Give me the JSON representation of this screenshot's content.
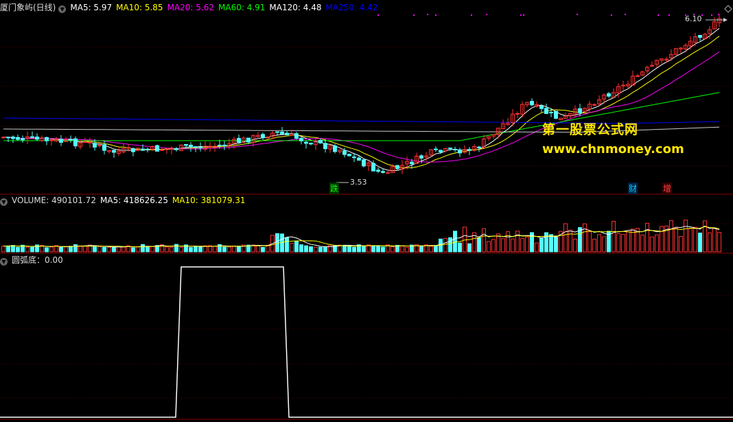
{
  "stock": {
    "title": "厦门象屿(日线)"
  },
  "ma_legend": [
    {
      "label": "MA5: 5.97",
      "color": "#ffffff"
    },
    {
      "label": "MA10: 5.85",
      "color": "#ffff00"
    },
    {
      "label": "MA20: 5.62",
      "color": "#ff00ff"
    },
    {
      "label": "MA60: 4.91",
      "color": "#00ff00"
    },
    {
      "label": "MA120: 4.48",
      "color": "#ffffff"
    },
    {
      "label": "MA250: 4.42",
      "color": "#0000ff"
    }
  ],
  "price_annotations": {
    "high": "6.10",
    "low": "3.53"
  },
  "event_tags": [
    {
      "text": "跌",
      "color": "#00ff00",
      "bg": "#004400"
    },
    {
      "text": "财",
      "color": "#00ccff",
      "bg": "#002244"
    },
    {
      "text": "增",
      "color": "#ff4444",
      "bg": "#330000"
    }
  ],
  "volume_legend": {
    "label": "VOLUME: 490101.72",
    "ma5": "MA5: 418626.25",
    "ma10": "MA10: 381079.31"
  },
  "indicator_legend": {
    "label": "圆弧底：0.00"
  },
  "watermark": {
    "line1": "第一股票公式网",
    "line2": "www.chnmoney.com"
  },
  "colors": {
    "up": "#ff3232",
    "down": "#54ffff",
    "grid": "#8b0000",
    "ma250": "#0000ff",
    "ma120": "#cccccc"
  },
  "chart_data": {
    "type": "candlestick",
    "indicator": {
      "name": "圆弧底",
      "ylim": [
        0,
        1
      ],
      "signal_on_range": [
        37,
        60
      ]
    },
    "price_range": [
      3.53,
      6.1
    ]
  }
}
